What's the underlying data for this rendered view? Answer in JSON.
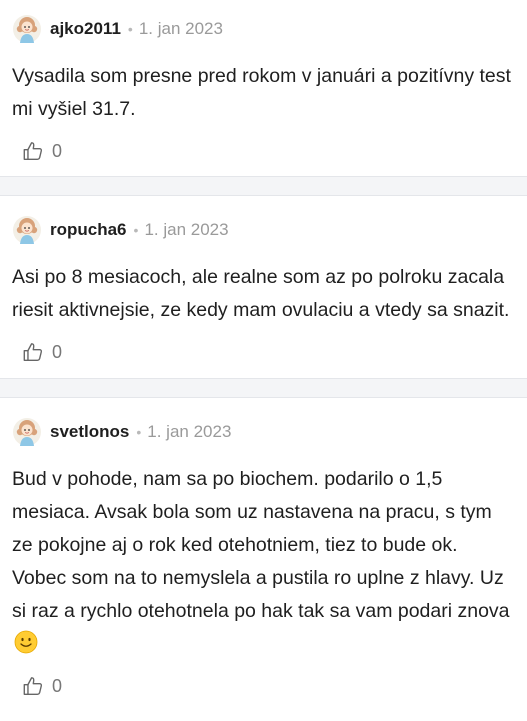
{
  "comments": [
    {
      "username": "ajko2011",
      "date": "1. jan 2023",
      "text": "Vysadila som presne pred rokom v januári a pozitívny test mi vyšiel 31.7.",
      "likes": "0",
      "avatar_icon": "girl-avatar-icon"
    },
    {
      "username": "ropucha6",
      "date": "1. jan 2023",
      "text": "Asi po 8 mesiacoch, ale realne som az po polroku zacala riesit aktivnejsie, ze kedy mam ovulaciu a vtedy sa snazit.",
      "likes": "0",
      "avatar_icon": "girl-avatar-icon"
    },
    {
      "username": "svetlonos",
      "date": "1. jan 2023",
      "text": "Bud v pohode, nam sa po biochem. podarilo o 1,5 mesiaca. Avsak bola som uz nastavena na pracu, s tym ze pokojne aj o rok ked otehotniem, tiez to bude ok. Vobec som na to nemyslela a pustila ro uplne z hlavy. Uz si raz a rychlo otehotnela po hak tak sa vam podari znova",
      "likes": "0",
      "avatar_icon": "girl-avatar-icon",
      "trailing_emoji": "smiling-face-emoji"
    }
  ],
  "colors": {
    "separator": "#f4f5f7",
    "text": "#1f1f1f",
    "muted": "#9a9a9a",
    "avatar_hair": "#d8a27a",
    "avatar_dress": "#8ec7e6"
  }
}
